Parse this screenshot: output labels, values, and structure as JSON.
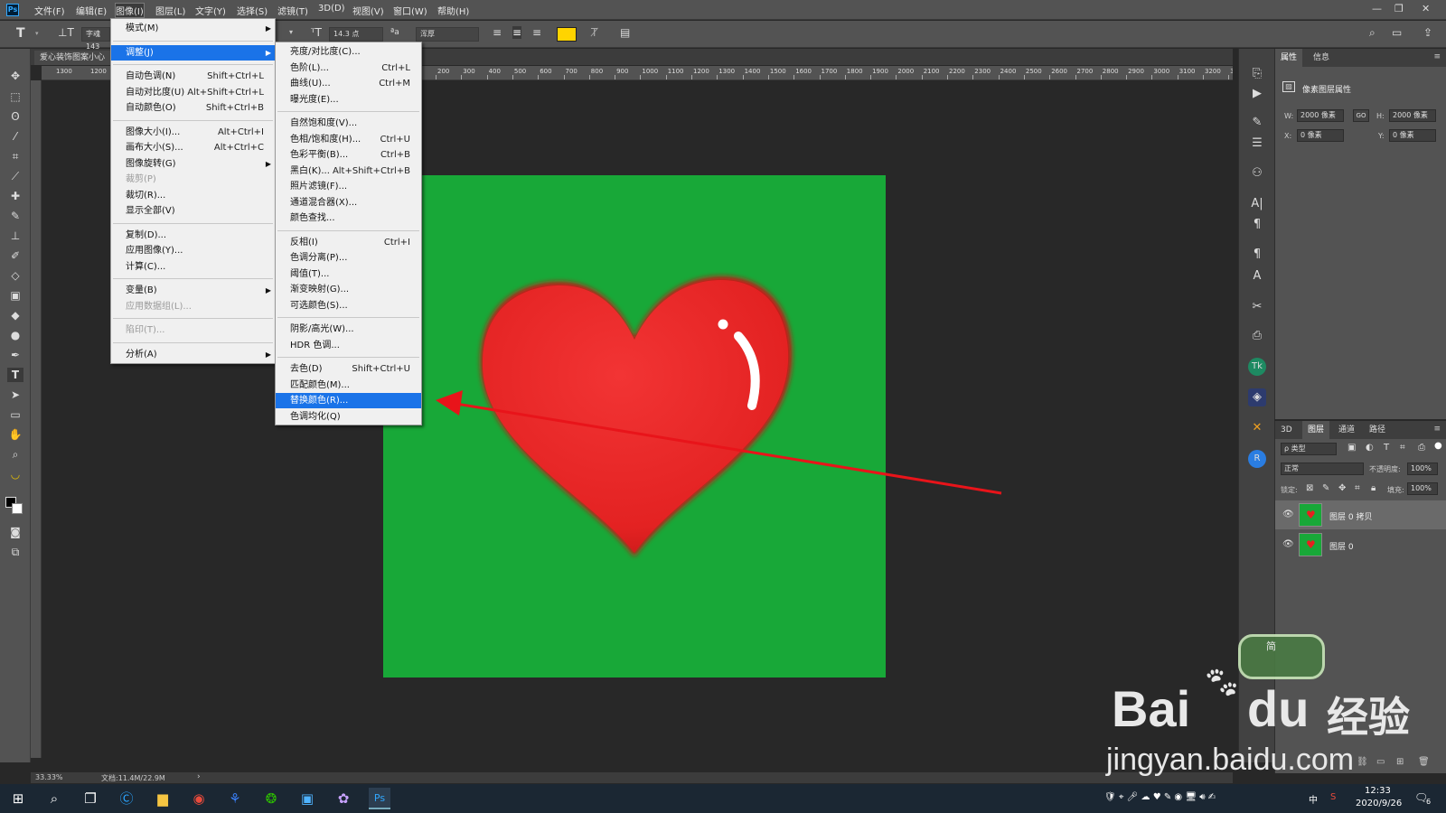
{
  "menubar": {
    "items": [
      "文件(F)",
      "编辑(E)",
      "图像(I)",
      "图层(L)",
      "文字(Y)",
      "选择(S)",
      "滤镜(T)",
      "3D(D)",
      "视图(V)",
      "窗口(W)",
      "帮助(H)"
    ],
    "active": "图像(I)"
  },
  "options": {
    "font_family": "字魂143",
    "font_size": "14.3 点",
    "antialias": "浑厚",
    "text_color": "#ffd400"
  },
  "document": {
    "tab_title": "爱心装饰图案小心"
  },
  "ruler": {
    "h_labels_left": [
      "1300",
      "1200"
    ],
    "h_labels": [
      "200",
      "300",
      "400",
      "500",
      "600",
      "700",
      "800",
      "900",
      "1000",
      "1100",
      "1200",
      "1300",
      "1400",
      "1500",
      "1600",
      "1700",
      "1800",
      "1900",
      "2000",
      "2100",
      "2200",
      "2300",
      "2400",
      "2500",
      "2600",
      "2700",
      "2800",
      "2900",
      "3000",
      "3100",
      "3200",
      "3300"
    ]
  },
  "statusbar": {
    "zoom": "33.33%",
    "doc": "文档:11.4M/22.9M"
  },
  "image_menu": {
    "items": [
      {
        "label": "模式(M)",
        "shortcut": "",
        "submenu": true
      },
      {
        "sep": true
      },
      {
        "label": "调整(J)",
        "shortcut": "",
        "submenu": true,
        "highlight": true
      },
      {
        "sep": true
      },
      {
        "label": "自动色调(N)",
        "shortcut": "Shift+Ctrl+L"
      },
      {
        "label": "自动对比度(U)",
        "shortcut": "Alt+Shift+Ctrl+L"
      },
      {
        "label": "自动颜色(O)",
        "shortcut": "Shift+Ctrl+B"
      },
      {
        "sep": true
      },
      {
        "label": "图像大小(I)...",
        "shortcut": "Alt+Ctrl+I"
      },
      {
        "label": "画布大小(S)...",
        "shortcut": "Alt+Ctrl+C"
      },
      {
        "label": "图像旋转(G)",
        "shortcut": "",
        "submenu": true
      },
      {
        "label": "裁剪(P)",
        "shortcut": "",
        "disabled": true
      },
      {
        "label": "裁切(R)...",
        "shortcut": ""
      },
      {
        "label": "显示全部(V)",
        "shortcut": ""
      },
      {
        "sep": true
      },
      {
        "label": "复制(D)...",
        "shortcut": ""
      },
      {
        "label": "应用图像(Y)...",
        "shortcut": ""
      },
      {
        "label": "计算(C)...",
        "shortcut": ""
      },
      {
        "sep": true
      },
      {
        "label": "变量(B)",
        "shortcut": "",
        "submenu": true
      },
      {
        "label": "应用数据组(L)...",
        "shortcut": "",
        "disabled": true
      },
      {
        "sep": true
      },
      {
        "label": "陷印(T)...",
        "shortcut": "",
        "disabled": true
      },
      {
        "sep": true
      },
      {
        "label": "分析(A)",
        "shortcut": "",
        "submenu": true
      }
    ]
  },
  "adjust_menu": {
    "items": [
      {
        "label": "亮度/对比度(C)...",
        "shortcut": ""
      },
      {
        "label": "色阶(L)...",
        "shortcut": "Ctrl+L"
      },
      {
        "label": "曲线(U)...",
        "shortcut": "Ctrl+M"
      },
      {
        "label": "曝光度(E)...",
        "shortcut": ""
      },
      {
        "sep": true
      },
      {
        "label": "自然饱和度(V)...",
        "shortcut": ""
      },
      {
        "label": "色相/饱和度(H)...",
        "shortcut": "Ctrl+U"
      },
      {
        "label": "色彩平衡(B)...",
        "shortcut": "Ctrl+B"
      },
      {
        "label": "黑白(K)...",
        "shortcut": "Alt+Shift+Ctrl+B"
      },
      {
        "label": "照片滤镜(F)...",
        "shortcut": ""
      },
      {
        "label": "通道混合器(X)...",
        "shortcut": ""
      },
      {
        "label": "颜色查找...",
        "shortcut": ""
      },
      {
        "sep": true
      },
      {
        "label": "反相(I)",
        "shortcut": "Ctrl+I"
      },
      {
        "label": "色调分离(P)...",
        "shortcut": ""
      },
      {
        "label": "阈值(T)...",
        "shortcut": ""
      },
      {
        "label": "渐变映射(G)...",
        "shortcut": ""
      },
      {
        "label": "可选颜色(S)...",
        "shortcut": ""
      },
      {
        "sep": true
      },
      {
        "label": "阴影/高光(W)...",
        "shortcut": ""
      },
      {
        "label": "HDR 色调...",
        "shortcut": ""
      },
      {
        "sep": true
      },
      {
        "label": "去色(D)",
        "shortcut": "Shift+Ctrl+U"
      },
      {
        "label": "匹配颜色(M)...",
        "shortcut": ""
      },
      {
        "label": "替换颜色(R)...",
        "shortcut": "",
        "highlight": true
      },
      {
        "label": "色调均化(Q)",
        "shortcut": ""
      }
    ]
  },
  "properties": {
    "tabs": [
      "属性",
      "信息"
    ],
    "title": "像素图层属性",
    "w_label": "W:",
    "w": "2000 像素",
    "h_label": "H:",
    "h": "2000 像素",
    "x_label": "X:",
    "x": "0 像素",
    "y_label": "Y:",
    "y": "0 像素",
    "link": "GO"
  },
  "layers": {
    "tabs": [
      "3D",
      "图层",
      "通道",
      "路径"
    ],
    "filter": "ρ 类型",
    "blend": "正常",
    "opacity_label": "不透明度:",
    "opacity": "100%",
    "lock_label": "锁定:",
    "fill_label": "填充:",
    "fill": "100%",
    "rows": [
      {
        "name": "图层 0 拷贝"
      },
      {
        "name": "图层 0"
      }
    ]
  },
  "taskbar": {
    "time": "12:33",
    "date": "2020/9/26",
    "ime": "中",
    "notif": "6"
  },
  "watermark": {
    "text1": "Bai",
    "text2": "du",
    "text3": "经验",
    "url": "jingyan.baidu.com",
    "ime_text": "简"
  },
  "colors": {
    "canvas": "#18a838",
    "heart": "#e82024",
    "highlight": "#1a73e8"
  }
}
